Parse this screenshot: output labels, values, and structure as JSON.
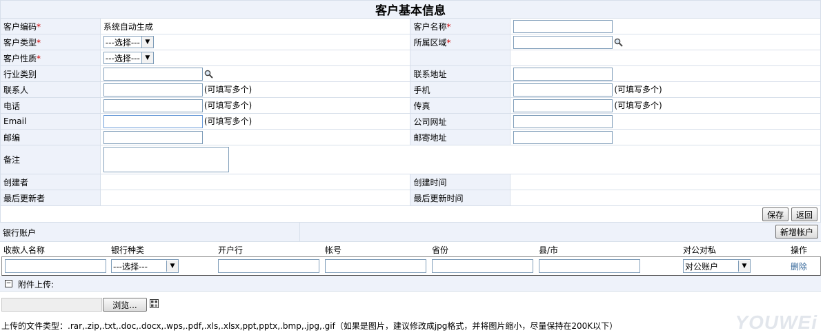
{
  "title": "客户基本信息",
  "fields": {
    "code_label": "客户编码",
    "code_value": "系统自动生成",
    "name_label": "客户名称",
    "type_label": "客户类型",
    "region_label": "所属区域",
    "nature_label": "客户性质",
    "industry_label": "行业类别",
    "address_label": "联系地址",
    "contact_label": "联系人",
    "mobile_label": "手机",
    "phone_label": "电话",
    "fax_label": "传真",
    "email_label": "Email",
    "website_label": "公司网址",
    "zip_label": "邮编",
    "mail_address_label": "邮寄地址",
    "remark_label": "备注",
    "creator_label": "创建者",
    "created_time_label": "创建时间",
    "updater_label": "最后更新者",
    "updated_time_label": "最后更新时间",
    "required_mark": "*",
    "select_default": "---选择---",
    "multi_note": "(可填写多个)"
  },
  "buttons": {
    "save": "保存",
    "back": "返回",
    "add_account": "新增帐户",
    "browse": "浏览..."
  },
  "bank": {
    "title": "银行账户",
    "headers": [
      "收款人名称",
      "银行种类",
      "开户行",
      "帐号",
      "省份",
      "县/市",
      "对公对私",
      "操作"
    ],
    "row": {
      "bank_type": "---选择---",
      "account_type": "对公账户",
      "action": "删除"
    }
  },
  "attach": {
    "label": "附件上传:",
    "types_text": "上传的文件类型：.rar,.zip,.txt,.doc,.docx,.wps,.pdf,.xls,.xlsx,ppt,pptx,.bmp,.jpg,.gif（如果是图片，建议修改成jpg格式，并将图片缩小，尽量保持在200K以下）"
  },
  "watermark": "YOUWEi",
  "icons": {
    "search": "magnifier-icon",
    "collapse": "minus-box-icon",
    "file": "grid-icon"
  }
}
